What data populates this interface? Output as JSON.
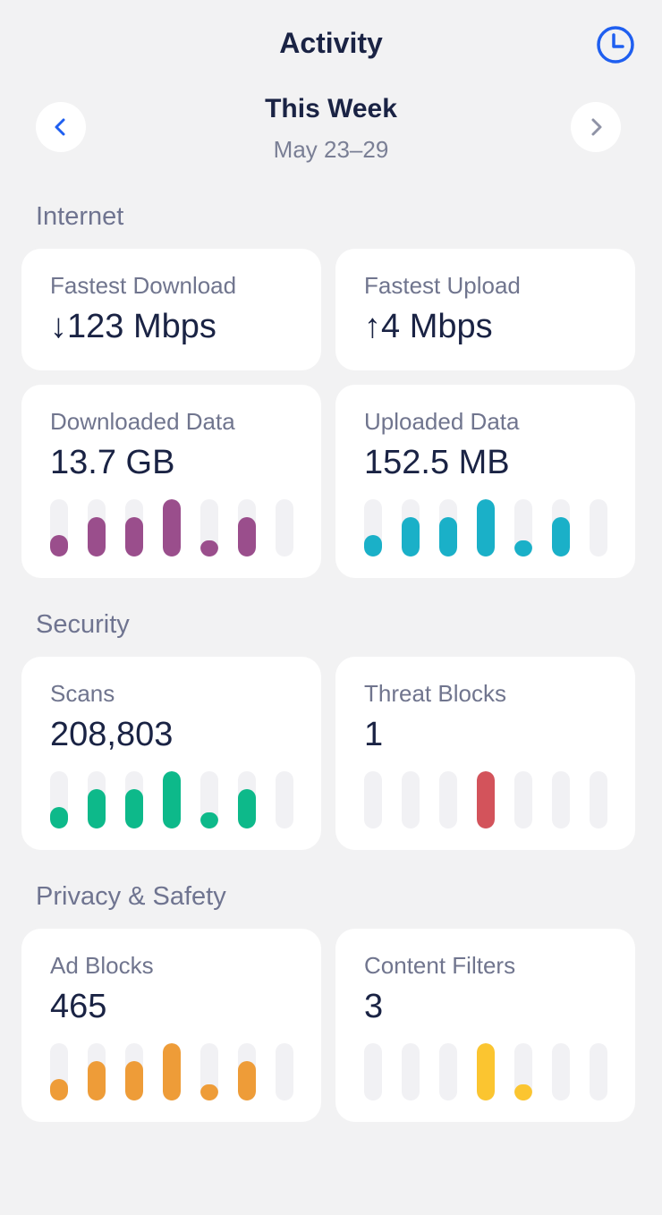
{
  "header": {
    "title": "Activity",
    "history_icon": "clock-icon"
  },
  "period": {
    "title": "This Week",
    "range": "May 23–29",
    "prev_icon": "chevron-left-icon",
    "next_icon": "chevron-right-icon"
  },
  "colors": {
    "accent": "#1f5ff0",
    "downloaded": "#9a4e8c",
    "uploaded": "#1ab0c8",
    "scans": "#0db98a",
    "threats": "#d3535b",
    "ads": "#ee9c38",
    "filters": "#fbc530",
    "track": "#f1f1f4"
  },
  "sections": {
    "internet": "Internet",
    "security": "Security",
    "privacy": "Privacy & Safety"
  },
  "cards": {
    "fastest_download": {
      "label": "Fastest Download",
      "value": "↓123 Mbps"
    },
    "fastest_upload": {
      "label": "Fastest Upload",
      "value": "↑4 Mbps"
    },
    "downloaded_data": {
      "label": "Downloaded Data",
      "value": "13.7 GB"
    },
    "uploaded_data": {
      "label": "Uploaded Data",
      "value": "152.5 MB"
    },
    "scans": {
      "label": "Scans",
      "value": "208,803"
    },
    "threat_blocks": {
      "label": "Threat Blocks",
      "value": "1"
    },
    "ad_blocks": {
      "label": "Ad Blocks",
      "value": "465"
    },
    "content_filters": {
      "label": "Content Filters",
      "value": "3"
    }
  },
  "chart_data": [
    {
      "type": "bar",
      "name": "downloaded_data",
      "values": [
        0.38,
        0.69,
        0.69,
        1.0,
        0.28,
        0.69,
        0
      ],
      "ylim": [
        0,
        1
      ]
    },
    {
      "type": "bar",
      "name": "uploaded_data",
      "values": [
        0.38,
        0.69,
        0.69,
        1.0,
        0.28,
        0.69,
        0
      ],
      "ylim": [
        0,
        1
      ]
    },
    {
      "type": "bar",
      "name": "scans",
      "values": [
        0.38,
        0.69,
        0.69,
        1.0,
        0.28,
        0.69,
        0
      ],
      "ylim": [
        0,
        1
      ]
    },
    {
      "type": "bar",
      "name": "threat_blocks",
      "values": [
        0,
        0,
        0,
        1.0,
        0,
        0,
        0
      ],
      "ylim": [
        0,
        1
      ]
    },
    {
      "type": "bar",
      "name": "ad_blocks",
      "values": [
        0.38,
        0.69,
        0.69,
        1.0,
        0.28,
        0.69,
        0
      ],
      "ylim": [
        0,
        1
      ]
    },
    {
      "type": "bar",
      "name": "content_filters",
      "values": [
        0,
        0,
        0,
        1.0,
        0.28,
        0,
        0
      ],
      "ylim": [
        0,
        1
      ]
    }
  ]
}
